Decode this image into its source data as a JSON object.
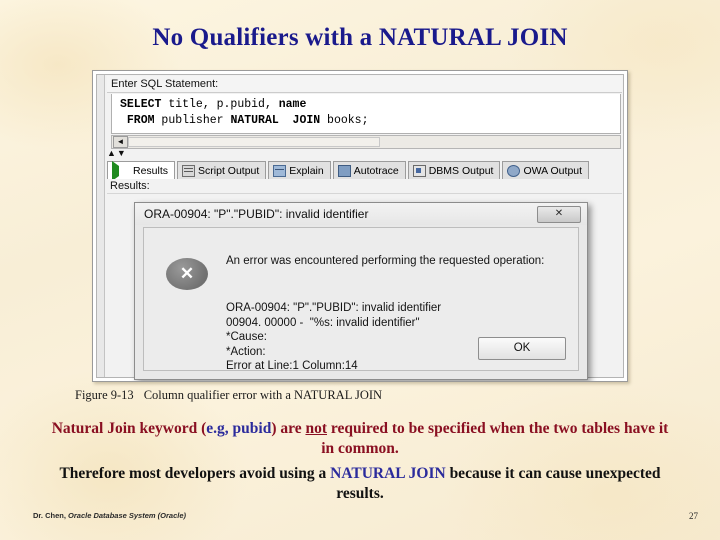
{
  "slide": {
    "title": "No Qualifiers with a NATURAL JOIN",
    "title_color": "#1a1a8c",
    "background_color": "#fbf2da"
  },
  "screenshot": {
    "sql_panel": {
      "label": "Enter SQL Statement:",
      "line1_keyword": "SELECT",
      "line1_rest": " title, p.pubid, ",
      "line1_keyword2": "name",
      "line2_keyword": " FROM",
      "line2_mid": " publisher ",
      "line2_keyword2": "NATURAL  JOIN",
      "line2_rest": " books;",
      "scroll_left_arrow": "◄",
      "updown_arrows": "▲▼"
    },
    "tabs": [
      {
        "label": "Results",
        "icon": "play-icon",
        "active": true
      },
      {
        "label": "Script Output",
        "icon": "document-icon",
        "active": false
      },
      {
        "label": "Explain",
        "icon": "grid-icon",
        "active": false
      },
      {
        "label": "Autotrace",
        "icon": "trace-icon",
        "active": false
      },
      {
        "label": "DBMS Output",
        "icon": "dbms-icon",
        "active": false
      },
      {
        "label": "OWA Output",
        "icon": "owa-icon",
        "active": false
      }
    ],
    "results_label": "Results:",
    "dialog": {
      "title": "ORA-00904: \"P\".\"PUBID\": invalid identifier",
      "close_label": "✕",
      "icon": "error-x-icon",
      "icon_glyph": "✕",
      "message": "An error was encountered performing the requested operation:",
      "detail": "ORA-00904: \"P\".\"PUBID\": invalid identifier\n00904. 00000 -  \"%s: invalid identifier\"\n*Cause:\n*Action:\nError at Line:1 Column:14",
      "ok_label": "OK"
    }
  },
  "caption": {
    "figure_number": "Figure 9-13",
    "text": "Column qualifier error with a NATURAL JOIN"
  },
  "body": {
    "para1_a": "Natural Join keyword (",
    "para1_blue": "e.g, pubid",
    "para1_b": ") are ",
    "para1_underline": "not",
    "para1_c": " required  to be specified when the two tables have it in common.",
    "para2_a": "Therefore most developers avoid using a ",
    "para2_blue": "NATURAL JOIN",
    "para2_b": " because it can cause unexpected results."
  },
  "footer": {
    "author": "Dr. Chen, ",
    "book": "Oracle Database System (Oracle)",
    "page_number": "27"
  }
}
